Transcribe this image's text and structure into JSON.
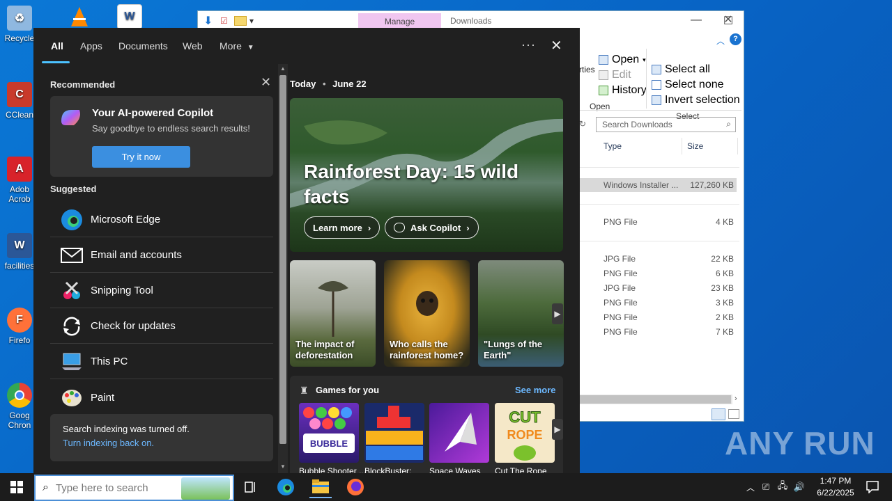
{
  "desktop": {
    "icons": [
      {
        "label": "Recycle",
        "color": "#7fb3e8"
      },
      {
        "label": "CClean",
        "color": "#d13b2f"
      },
      {
        "label": "Adob Acrob",
        "color": "#d8232a"
      },
      {
        "label": "facilities",
        "color": "#2b5797"
      },
      {
        "label": "Firefo",
        "color": "#ff7139"
      },
      {
        "label": "Goog Chron",
        "color": "#34a853"
      }
    ],
    "top_icons": [
      "vlc-icon",
      "word-icon"
    ]
  },
  "explorer": {
    "manage_tab": "Manage",
    "title": "Downloads",
    "ribbon": {
      "open": "Open",
      "edit": "Edit",
      "history": "History",
      "properties_partial": "rties",
      "open_group": "Open",
      "select_all": "Select all",
      "select_none": "Select none",
      "invert_selection": "Invert selection",
      "select_group": "Select"
    },
    "search_placeholder": "Search Downloads",
    "columns": {
      "type": "Type",
      "size": "Size"
    },
    "rows": [
      {
        "type": "Windows Installer ...",
        "size": "127,260 KB",
        "selected": true
      },
      {
        "type": "PNG File",
        "size": "4 KB"
      },
      {
        "type": "JPG File",
        "size": "22 KB"
      },
      {
        "type": "PNG File",
        "size": "6 KB"
      },
      {
        "type": "JPG File",
        "size": "23 KB"
      },
      {
        "type": "PNG File",
        "size": "3 KB"
      },
      {
        "type": "PNG File",
        "size": "2 KB"
      },
      {
        "type": "PNG File",
        "size": "7 KB"
      }
    ]
  },
  "search_panel": {
    "tabs": {
      "all": "All",
      "apps": "Apps",
      "documents": "Documents",
      "web": "Web",
      "more": "More"
    },
    "recommended": "Recommended",
    "copilot": {
      "title": "Your AI-powered Copilot",
      "subtitle": "Say goodbye to endless search results!",
      "button": "Try it now"
    },
    "suggested": "Suggested",
    "suggestions": [
      "Microsoft Edge",
      "Email and accounts",
      "Snipping Tool",
      "Check for updates",
      "This PC",
      "Paint"
    ],
    "indexing": {
      "message": "Search indexing was turned off.",
      "link": "Turn indexing back on."
    },
    "today": {
      "label": "Today",
      "date": "June 22"
    },
    "hero": {
      "title": "Rainforest Day: 15 wild facts",
      "learn_more": "Learn more",
      "ask_copilot": "Ask Copilot"
    },
    "cards": [
      "The impact of deforestation",
      "Who calls the rainforest home?",
      "\"Lungs of the Earth\""
    ],
    "games": {
      "title": "Games for you",
      "see_more": "See more",
      "items": [
        "Bubble Shooter ...",
        "BlockBuster:",
        "Space Waves",
        "Cut The Rope"
      ]
    }
  },
  "taskbar": {
    "search_placeholder": "Type here to search",
    "time": "1:47 PM",
    "date": "6/22/2025"
  },
  "watermark": "ANY RUN"
}
